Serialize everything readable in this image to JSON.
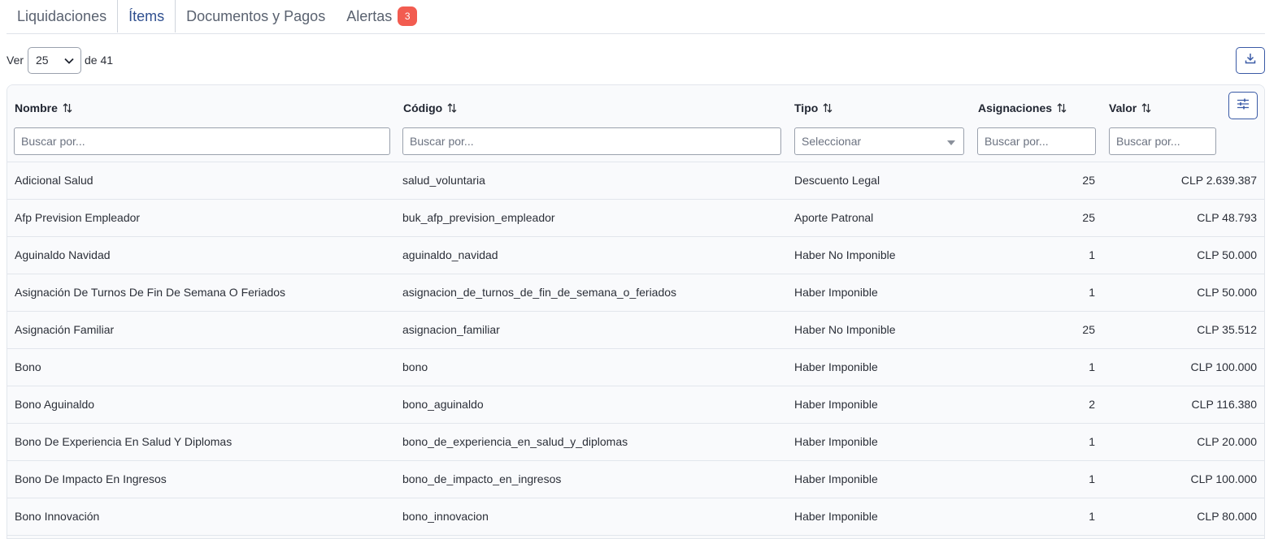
{
  "tabs": [
    {
      "label": "Liquidaciones",
      "active": false
    },
    {
      "label": "Ítems",
      "active": true
    },
    {
      "label": "Documentos y Pagos",
      "active": false
    },
    {
      "label": "Alertas",
      "active": false,
      "badge": "3"
    }
  ],
  "pager": {
    "ver_label": "Ver",
    "page_size": "25",
    "of_label": "de 41"
  },
  "table": {
    "columns": [
      {
        "label": "Nombre",
        "placeholder": "Buscar por..."
      },
      {
        "label": "Código",
        "placeholder": "Buscar por..."
      },
      {
        "label": "Tipo",
        "placeholder": "Seleccionar"
      },
      {
        "label": "Asignaciones",
        "placeholder": "Buscar por..."
      },
      {
        "label": "Valor",
        "placeholder": "Buscar por..."
      }
    ],
    "rows": [
      {
        "nombre": "Adicional Salud",
        "codigo": "salud_voluntaria",
        "tipo": "Descuento Legal",
        "asignaciones": "25",
        "valor": "CLP 2.639.387"
      },
      {
        "nombre": "Afp Prevision Empleador",
        "codigo": "buk_afp_prevision_empleador",
        "tipo": "Aporte Patronal",
        "asignaciones": "25",
        "valor": "CLP 48.793"
      },
      {
        "nombre": "Aguinaldo Navidad",
        "codigo": "aguinaldo_navidad",
        "tipo": "Haber No Imponible",
        "asignaciones": "1",
        "valor": "CLP 50.000"
      },
      {
        "nombre": "Asignación De Turnos De Fin De Semana O Feriados",
        "codigo": "asignacion_de_turnos_de_fin_de_semana_o_feriados",
        "tipo": "Haber Imponible",
        "asignaciones": "1",
        "valor": "CLP 50.000"
      },
      {
        "nombre": "Asignación Familiar",
        "codigo": "asignacion_familiar",
        "tipo": "Haber No Imponible",
        "asignaciones": "25",
        "valor": "CLP 35.512"
      },
      {
        "nombre": "Bono",
        "codigo": "bono",
        "tipo": "Haber Imponible",
        "asignaciones": "1",
        "valor": "CLP 100.000"
      },
      {
        "nombre": "Bono Aguinaldo",
        "codigo": "bono_aguinaldo",
        "tipo": "Haber Imponible",
        "asignaciones": "2",
        "valor": "CLP 116.380"
      },
      {
        "nombre": "Bono De Experiencia En Salud Y Diplomas",
        "codigo": "bono_de_experiencia_en_salud_y_diplomas",
        "tipo": "Haber Imponible",
        "asignaciones": "1",
        "valor": "CLP 20.000"
      },
      {
        "nombre": "Bono De Impacto En Ingresos",
        "codigo": "bono_de_impacto_en_ingresos",
        "tipo": "Haber Imponible",
        "asignaciones": "1",
        "valor": "CLP 100.000"
      },
      {
        "nombre": "Bono Innovación",
        "codigo": "bono_innovacion",
        "tipo": "Haber Imponible",
        "asignaciones": "1",
        "valor": "CLP 80.000"
      }
    ]
  },
  "icons": {
    "download": "download-icon",
    "settings": "sliders-icon",
    "sort": "sort-arrows-icon",
    "chevron": "chevron-down-icon",
    "caret": "caret-down-icon"
  },
  "colors": {
    "accent": "#2f4f8f",
    "badge": "#f25c50"
  }
}
